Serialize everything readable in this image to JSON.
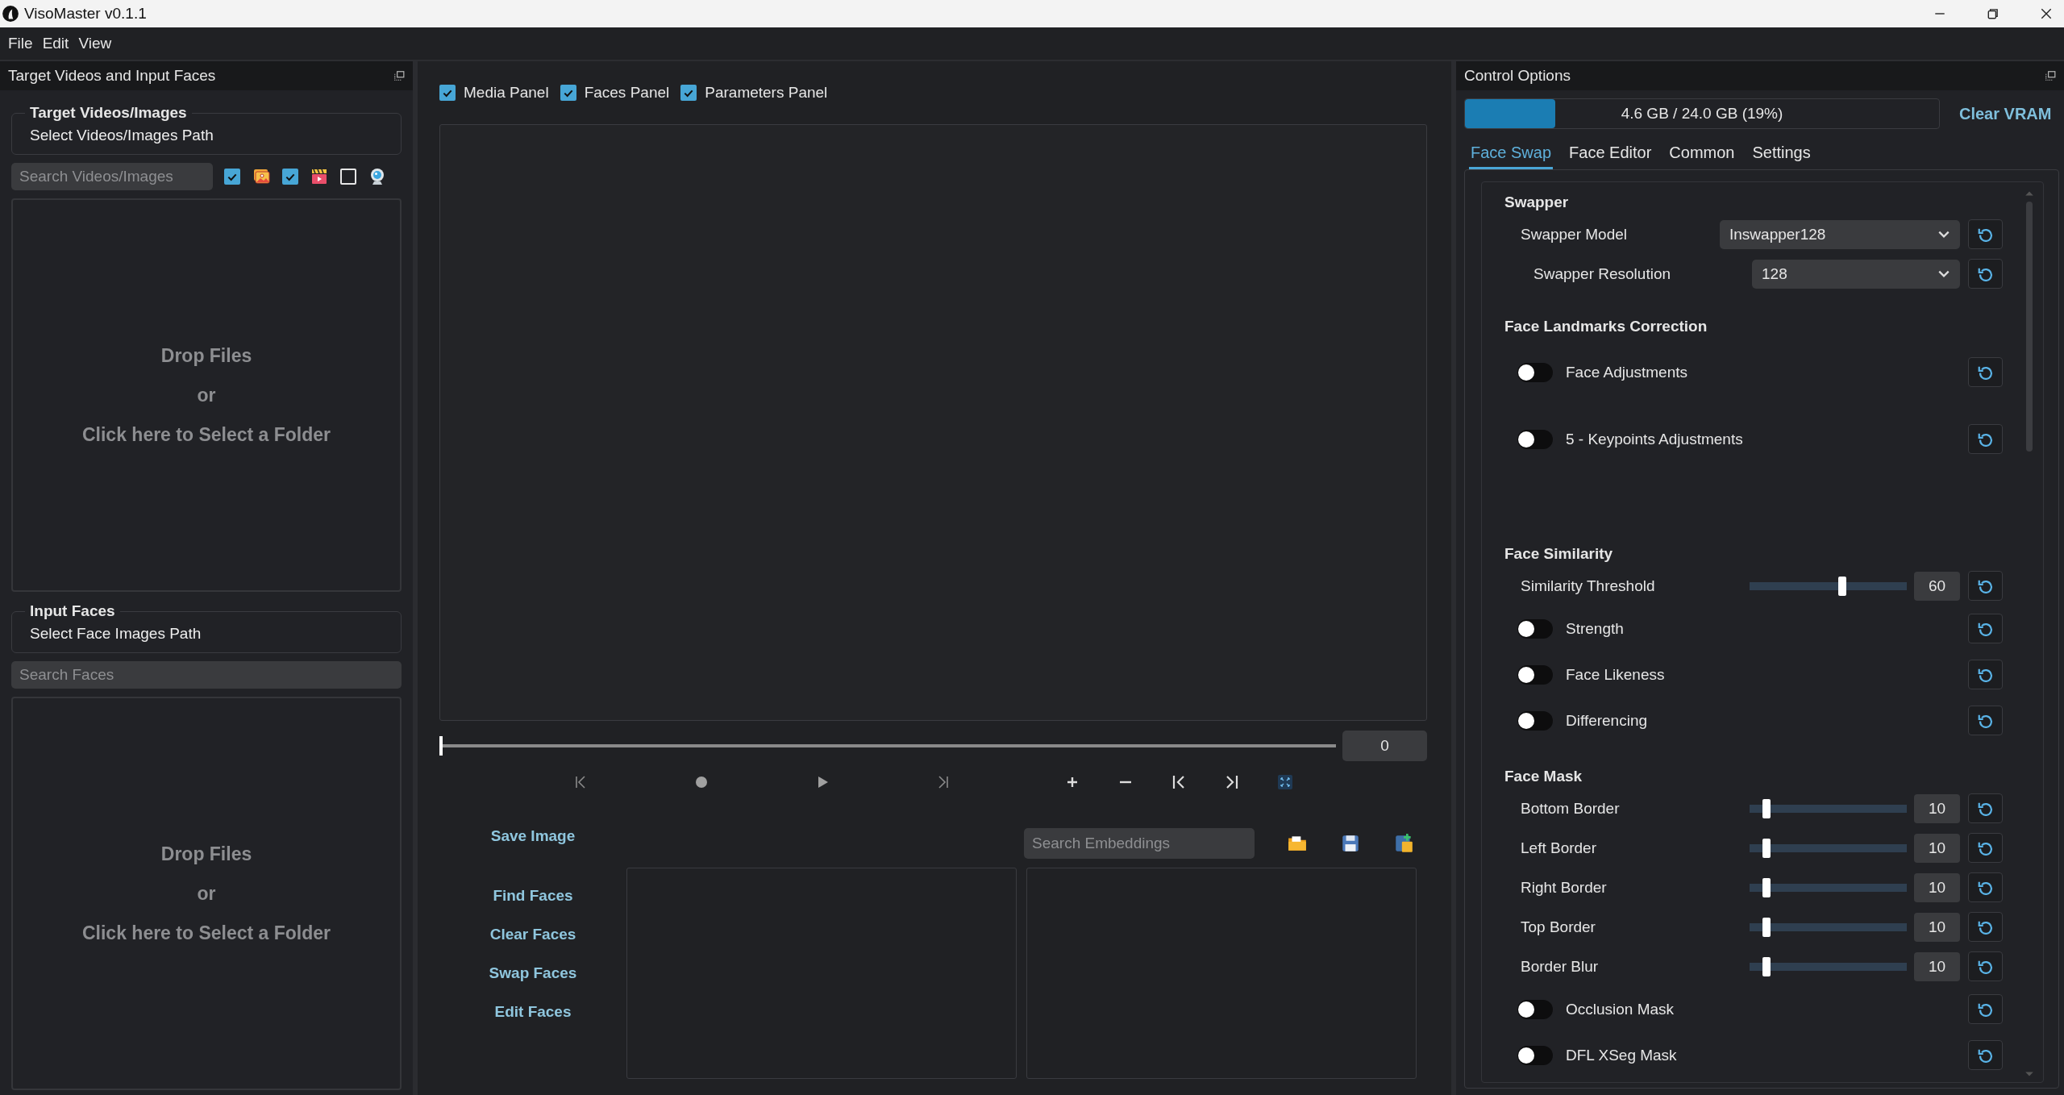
{
  "window": {
    "title": "VisoMaster v0.1.1"
  },
  "menu": [
    "File",
    "Edit",
    "View"
  ],
  "left_panel": {
    "title": "Target Videos and Input Faces",
    "target_group": {
      "title": "Target Videos/Images",
      "path_button": "Select Videos/Images Path"
    },
    "target_search": {
      "placeholder": "Search Videos/Images"
    },
    "filters": [
      {
        "kind": "images",
        "checked": true
      },
      {
        "kind": "videos",
        "checked": true
      },
      {
        "kind": "webcam",
        "checked": false
      }
    ],
    "target_drop": [
      "Drop Files",
      "or",
      "Click here to Select a Folder"
    ],
    "faces_group": {
      "title": "Input Faces",
      "path_button": "Select Face Images Path"
    },
    "faces_search": {
      "placeholder": "Search Faces"
    },
    "faces_drop": [
      "Drop Files",
      "or",
      "Click here to Select a Folder"
    ]
  },
  "center": {
    "panel_toggles": [
      {
        "label": "Media Panel",
        "checked": true
      },
      {
        "label": "Faces Panel",
        "checked": true
      },
      {
        "label": "Parameters Panel",
        "checked": true
      }
    ],
    "timeline": {
      "level": 0,
      "value": "0"
    },
    "save_button": "Save Image",
    "face_buttons": [
      "Find Faces",
      "Clear Faces",
      "Swap Faces",
      "Edit Faces"
    ],
    "embeddings_search": {
      "placeholder": "Search Embeddings"
    }
  },
  "right_panel": {
    "title": "Control Options",
    "vram": {
      "level": 0.19,
      "label": "4.6 GB / 24.0 GB (19%)"
    },
    "clear_button": "Clear VRAM",
    "tabs": [
      {
        "label": "Face Swap",
        "selected": true
      },
      {
        "label": "Face Editor",
        "selected": false
      },
      {
        "label": "Common",
        "selected": false
      },
      {
        "label": "Settings",
        "selected": false
      }
    ],
    "sections": [
      {
        "title": "Swapper",
        "rows": [
          {
            "kind": "select",
            "label": "Swapper Model",
            "value": "Inswapper128"
          },
          {
            "kind": "select",
            "label": "Swapper Resolution",
            "value": "128"
          }
        ]
      },
      {
        "title": "Face Landmarks Correction",
        "rows": [
          {
            "kind": "toggle",
            "label": "Face Adjustments",
            "on": false
          },
          {
            "kind": "toggle",
            "label": "5 - Keypoints Adjustments",
            "on": false
          }
        ]
      },
      {
        "title": "Face Similarity",
        "rows": [
          {
            "kind": "slider",
            "label": "Similarity Threshold",
            "level": 0.59,
            "value": "60"
          },
          {
            "kind": "toggle",
            "label": "Strength",
            "on": false
          },
          {
            "kind": "toggle",
            "label": "Face Likeness",
            "on": false
          },
          {
            "kind": "toggle",
            "label": "Differencing",
            "on": false
          }
        ]
      },
      {
        "title": "Face Mask",
        "rows": [
          {
            "kind": "slider",
            "label": "Bottom Border",
            "level": 0.11,
            "value": "10"
          },
          {
            "kind": "slider",
            "label": "Left Border",
            "level": 0.11,
            "value": "10"
          },
          {
            "kind": "slider",
            "label": "Right Border",
            "level": 0.11,
            "value": "10"
          },
          {
            "kind": "slider",
            "label": "Top Border",
            "level": 0.11,
            "value": "10"
          },
          {
            "kind": "slider",
            "label": "Border Blur",
            "level": 0.11,
            "value": "10"
          },
          {
            "kind": "toggle",
            "label": "Occlusion Mask",
            "on": false
          },
          {
            "kind": "toggle",
            "label": "DFL XSeg Mask",
            "on": false
          }
        ]
      }
    ]
  }
}
